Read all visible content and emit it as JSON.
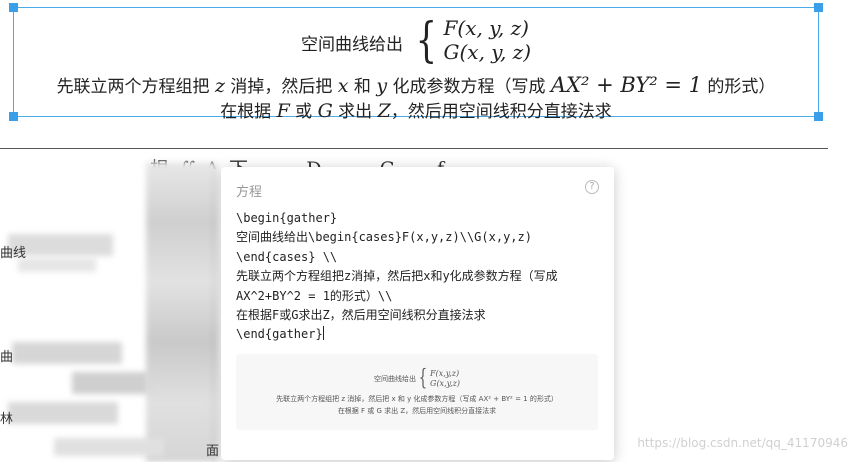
{
  "formula": {
    "line1_prefix": "空间曲线给出",
    "brace": "{",
    "case1": "F(x, y, z)",
    "case2": "G(x, y, z)",
    "line2_a": "先联立两个方程组把 ",
    "line2_z": "z",
    "line2_b": " 消掉，然后把 ",
    "line2_x": "x",
    "line2_c": " 和 ",
    "line2_y": "y",
    "line2_d": " 化成参数方程（写成 ",
    "line2_eq": "AX² + BY² = 1",
    "line2_e": " 的形式）",
    "line3_a": "在根据 ",
    "line3_F": "F",
    "line3_b": " 或 ",
    "line3_G": "G",
    "line3_c": " 求出 ",
    "line3_Z": "Z",
    "line3_d": "，然后用空间线积分直接法求"
  },
  "background": {
    "partial_math": "根  ∬   A  下  ·  ·  ·  D  ·  ·  ·  G  ·  ·  f",
    "edge_text_1": "曲线",
    "edge_text_2": "曲",
    "edge_text_3": "林",
    "edge_text_4": "面"
  },
  "popup": {
    "title": "方程",
    "help": "?",
    "code": "\\begin{gather}\n空间曲线给出\\begin{cases}F(x,y,z)\\\\G(x,y,z)\n\\end{cases} \\\\\n先联立两个方程组把z消掉，然后把x和y化成参数方程（写成\nAX^2+BY^2 = 1的形式）\\\\\n在根据F或G求出Z，然后用空间线积分直接法求\n\\end{gather}",
    "preview": {
      "line1_prefix": "空间曲线给出",
      "brace": "{",
      "case1": "F(x,y,z)",
      "case2": "G(x,y,z)",
      "line2": "先联立两个方程组把 z 消掉，然后把 x 和 y 化成参数方程（写成 AX² + BY² = 1 的形式）",
      "line3": "在根据 F 或 G 求出 Z，然后用空间线积分直接法求"
    }
  },
  "watermark": "https://blog.csdn.net/qq_41170946"
}
